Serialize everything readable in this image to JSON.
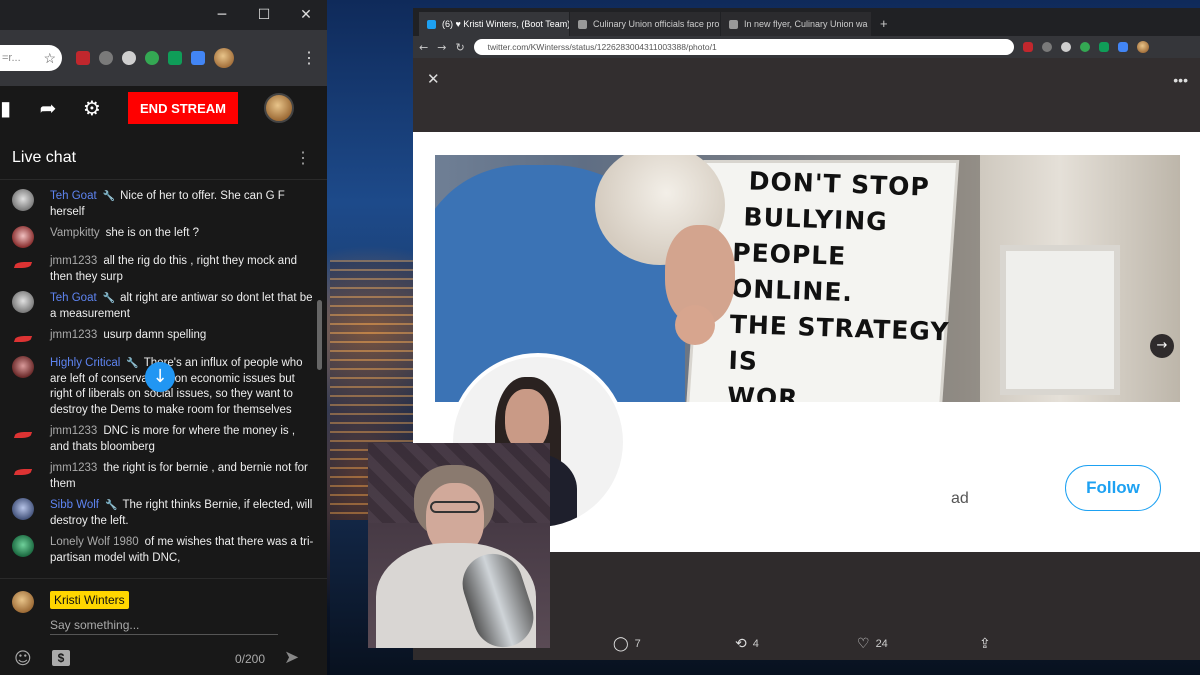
{
  "chat_window": {
    "stream_bar": {
      "end_stream_label": "END STREAM"
    },
    "chat_title": "Live chat",
    "messages": [
      {
        "author": "Teh Goat",
        "moderator": true,
        "avatar": "goat",
        "text": "Nice of her to offer. She can G F herself"
      },
      {
        "author": "Vampkitty",
        "moderator": false,
        "avatar": "vamp",
        "text": "she is on the left ?"
      },
      {
        "author": "jmm1233",
        "moderator": false,
        "avatar": "jmm",
        "text": "all the rig do this , right they mock and then they surp"
      },
      {
        "author": "Teh Goat",
        "moderator": true,
        "avatar": "goat",
        "text": "alt right are antiwar so dont let that be a measurement"
      },
      {
        "author": "jmm1233",
        "moderator": false,
        "avatar": "jmm",
        "text": "usurp damn spelling"
      },
      {
        "author": "Highly Critical",
        "moderator": true,
        "avatar": "hc",
        "text": "There's an influx of people who are left of conservatives on economic issues but right of liberals on social issues, so they want to destroy the Dems to make room for themselves"
      },
      {
        "author": "jmm1233",
        "moderator": false,
        "avatar": "jmm",
        "text": "DNC is more for where the money is , and thats bloomberg"
      },
      {
        "author": "jmm1233",
        "moderator": false,
        "avatar": "jmm",
        "text": "the right is for bernie , and bernie not for them"
      },
      {
        "author": "Sibb Wolf",
        "moderator": true,
        "avatar": "sibb",
        "text": "The right thinks Bernie, if elected, will destroy the left."
      },
      {
        "author": "Lonely Wolf 1980",
        "moderator": false,
        "avatar": "lw",
        "text": "of me wishes that there was a tri-partisan model with DNC,"
      }
    ],
    "compose": {
      "user_name": "Kristi Winters",
      "placeholder": "Say something...",
      "char_count": "0/200"
    }
  },
  "browser": {
    "tabs": [
      {
        "label": "(6) ♥ Kristi Winters, (Boot Team)",
        "active": true
      },
      {
        "label": "Culinary Union officials face pro",
        "active": false
      },
      {
        "label": "In new flyer, Culinary Union wa",
        "active": false
      }
    ],
    "url": "twitter.com/KWinterss/status/1226283004311003388/photo/1",
    "profile": {
      "banner_text_lines": [
        "DON'T STOP",
        "BULLYING",
        "PEOPLE ONLINE.",
        "THE STRATEGY IS",
        "WOR"
      ],
      "follow_label": "Follow",
      "bio_fragment": "ad"
    },
    "tweet_actions": {
      "replies": "7",
      "retweets": "4",
      "likes": "24"
    }
  },
  "colors": {
    "end_stream": "#ff0000",
    "moderator_name": "#5e84f1",
    "follow_blue": "#1da1f2",
    "name_badge": "#ffd600"
  }
}
